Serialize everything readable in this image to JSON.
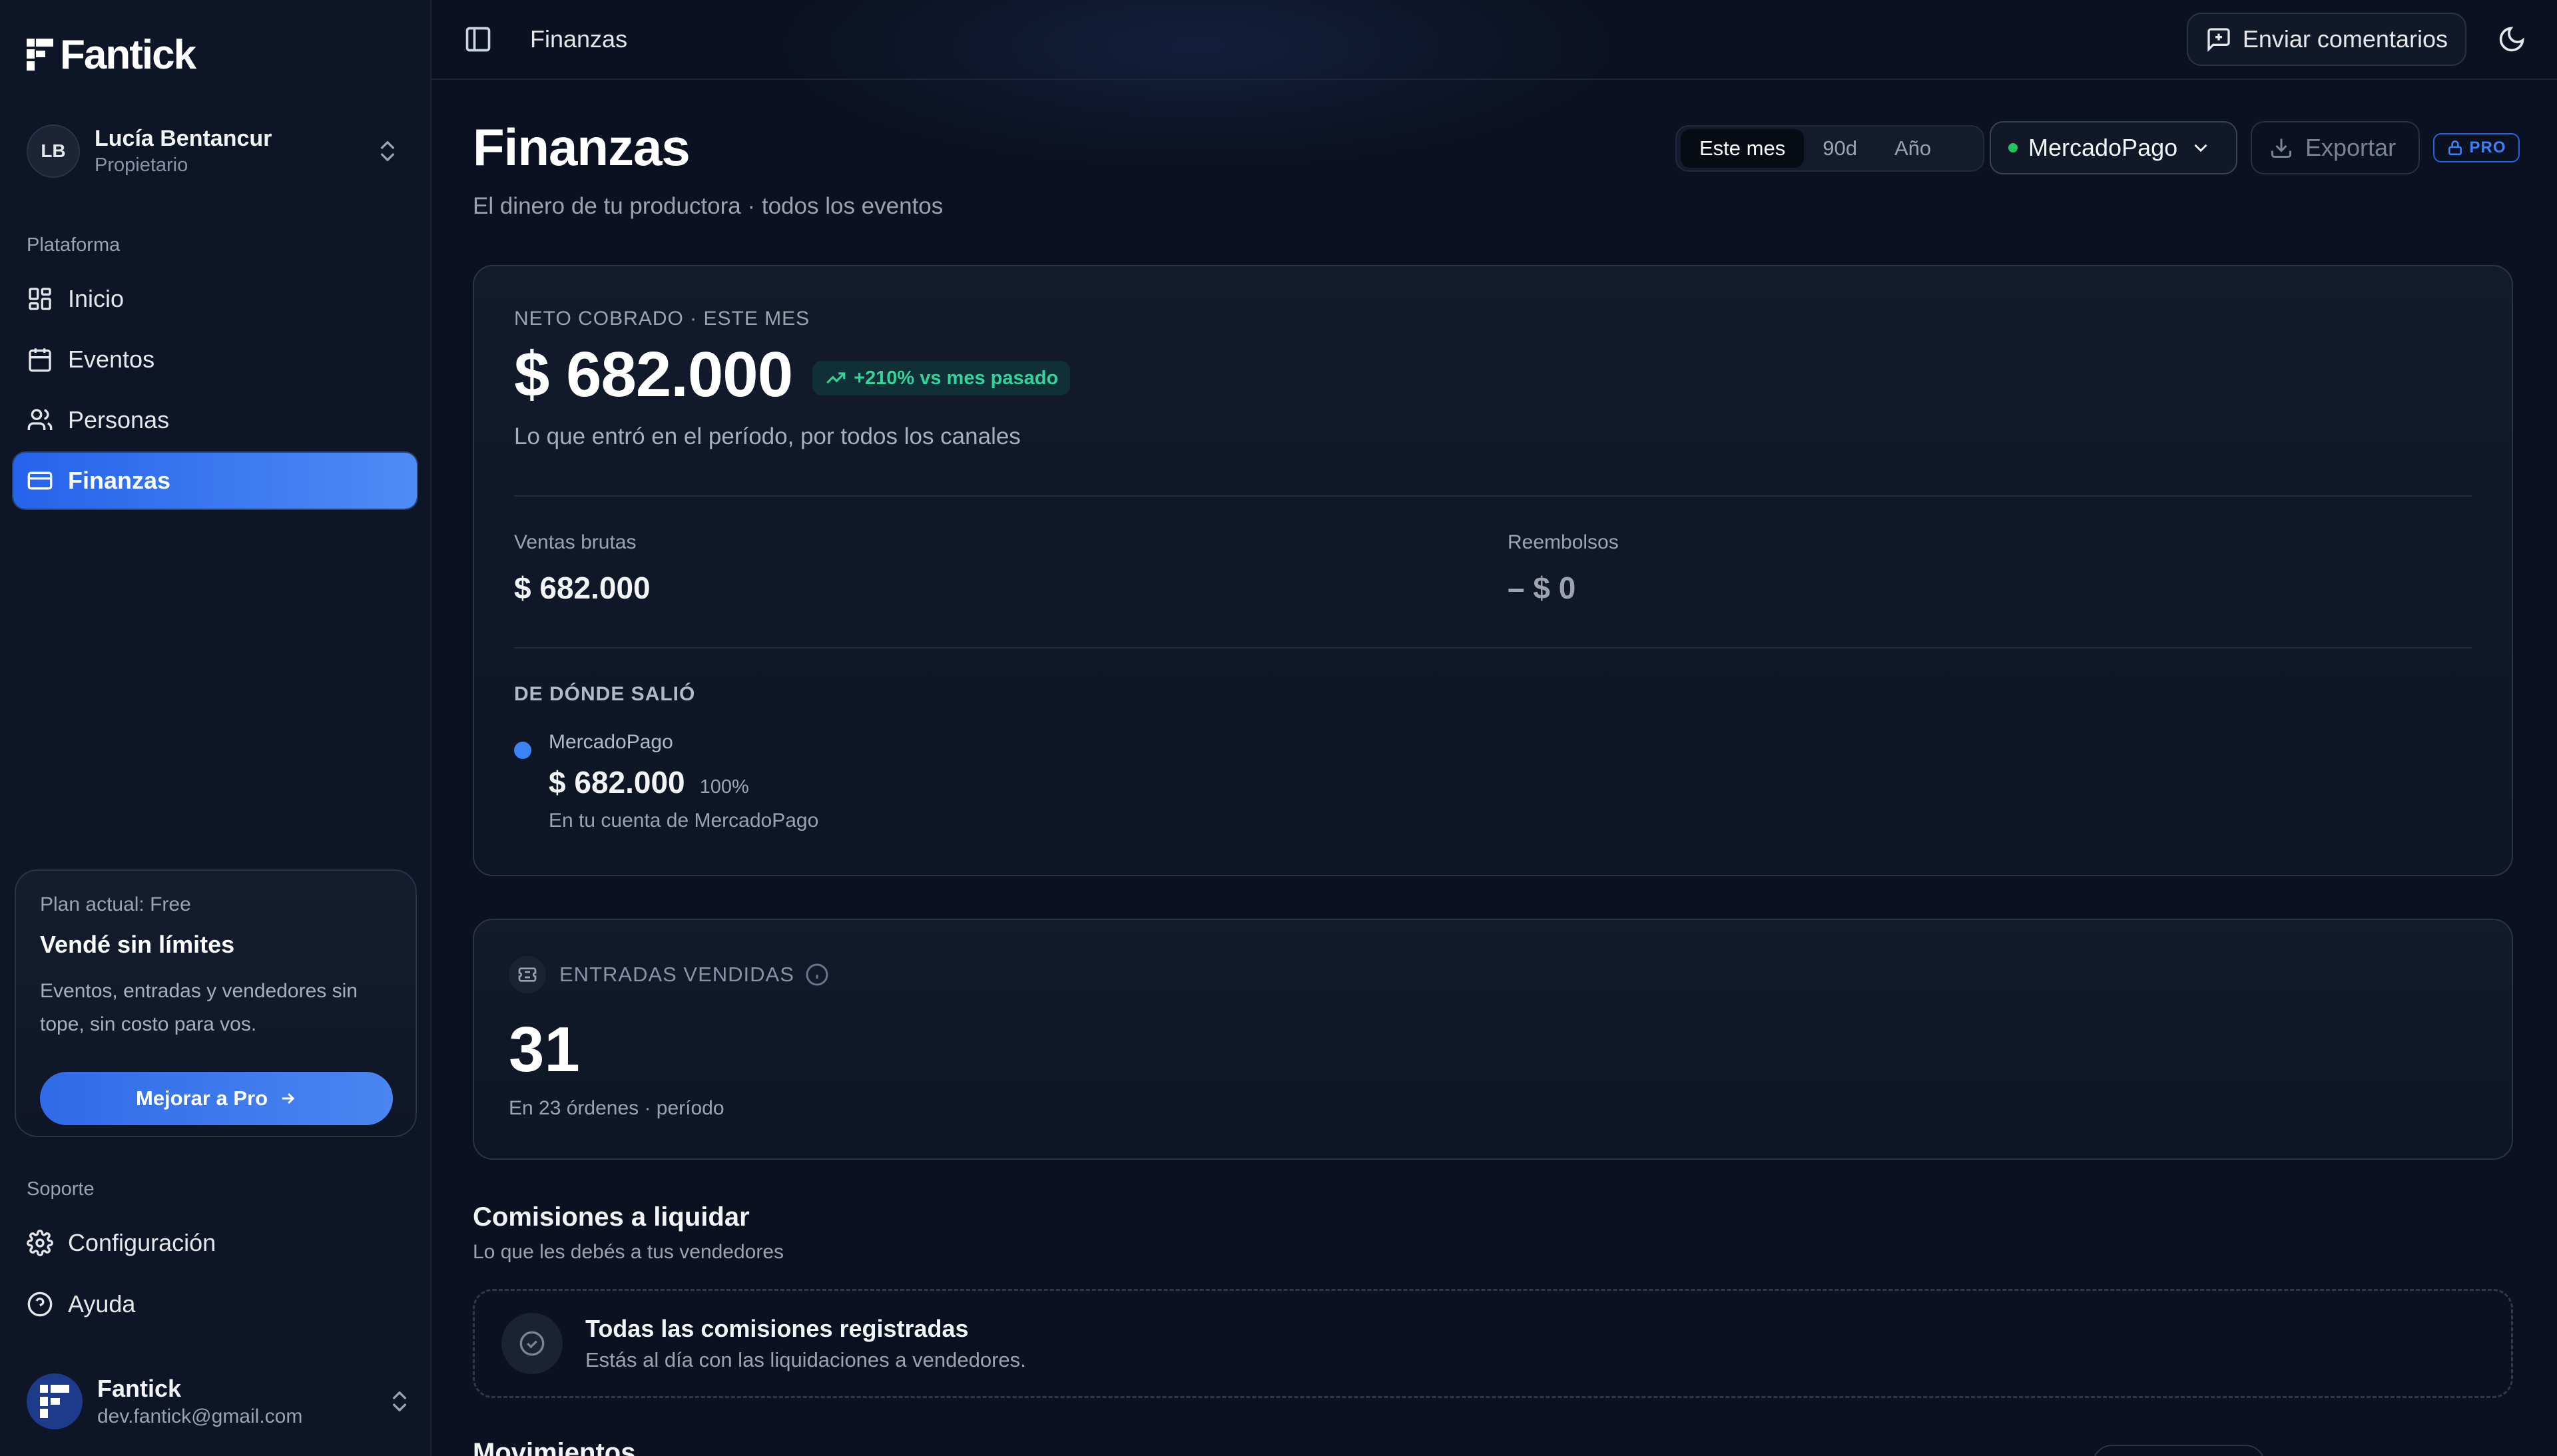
{
  "app": {
    "name": "Fantick"
  },
  "account": {
    "initials": "LB",
    "name": "Lucía Bentancur",
    "role": "Propietario"
  },
  "sidebar": {
    "platform_label": "Plataforma",
    "items": [
      {
        "label": "Inicio",
        "icon": "dashboard-icon"
      },
      {
        "label": "Eventos",
        "icon": "calendar-icon"
      },
      {
        "label": "Personas",
        "icon": "users-icon"
      },
      {
        "label": "Finanzas",
        "icon": "credit-card-icon",
        "active": true
      }
    ],
    "support_label": "Soporte",
    "support_items": [
      {
        "label": "Configuración",
        "icon": "gear-icon"
      },
      {
        "label": "Ayuda",
        "icon": "help-icon"
      }
    ]
  },
  "plan": {
    "current": "Plan actual: Free",
    "title": "Vendé sin límites",
    "description": "Eventos, entradas y vendedores sin tope, sin costo para vos.",
    "button": "Mejorar a Pro"
  },
  "user": {
    "name": "Fantick",
    "email": "dev.fantick@gmail.com"
  },
  "topbar": {
    "breadcrumb": "Finanzas",
    "feedback": "Enviar comentarios"
  },
  "header": {
    "title": "Finanzas",
    "subtitle": "El dinero de tu productora · todos los eventos",
    "periods": [
      "Este mes",
      "90d",
      "Año"
    ],
    "active_period": "Este mes",
    "provider": "MercadoPago",
    "export": "Exportar",
    "pro_badge": "PRO"
  },
  "net": {
    "kicker": "NETO COBRADO · ESTE MES",
    "amount": "$ 682.000",
    "trend": "+210% vs mes pasado",
    "caption": "Lo que entró en el período, por todos los canales",
    "gross_label": "Ventas brutas",
    "gross_value": "$ 682.000",
    "refunds_label": "Reembolsos",
    "refunds_value": "– $ 0",
    "source_kicker": "DE DÓNDE SALIÓ",
    "source": {
      "name": "MercadoPago",
      "amount": "$ 682.000",
      "share": "100%",
      "note": "En tu cuenta de MercadoPago",
      "color": "#3b82f6"
    }
  },
  "tickets": {
    "kicker": "ENTRADAS VENDIDAS",
    "count": "31",
    "caption": "En 23 órdenes · período"
  },
  "commissions": {
    "title": "Comisiones a liquidar",
    "subtitle": "Lo que les debés a tus vendedores",
    "empty_title": "Todas las comisiones registradas",
    "empty_sub": "Estás al día con las liquidaciones a vendedores."
  },
  "movements": {
    "title": "Movimientos"
  },
  "colors": {
    "accent": "#2563eb",
    "positive": "#34d399",
    "background": "#0b1120"
  }
}
